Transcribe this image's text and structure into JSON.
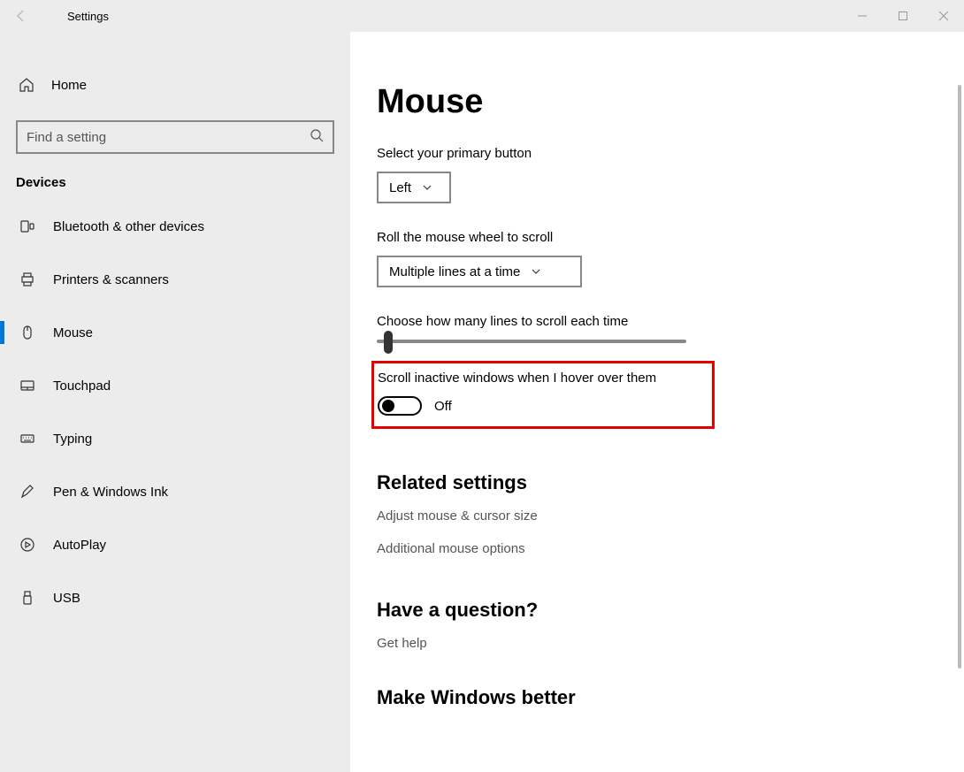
{
  "window": {
    "title": "Settings"
  },
  "sidebar": {
    "home": "Home",
    "search_placeholder": "Find a setting",
    "category": "Devices",
    "items": [
      {
        "label": "Bluetooth & other devices"
      },
      {
        "label": "Printers & scanners"
      },
      {
        "label": "Mouse"
      },
      {
        "label": "Touchpad"
      },
      {
        "label": "Typing"
      },
      {
        "label": "Pen & Windows Ink"
      },
      {
        "label": "AutoPlay"
      },
      {
        "label": "USB"
      }
    ]
  },
  "main": {
    "heading": "Mouse",
    "primary_label": "Select your primary button",
    "primary_value": "Left",
    "scroll_label": "Roll the mouse wheel to scroll",
    "scroll_value": "Multiple lines at a time",
    "lines_label": "Choose how many lines to scroll each time",
    "inactive_label": "Scroll inactive windows when I hover over them",
    "inactive_state": "Off",
    "related_head": "Related settings",
    "related_link1": "Adjust mouse & cursor size",
    "related_link2": "Additional mouse options",
    "question_head": "Have a question?",
    "question_link": "Get help",
    "better_head": "Make Windows better"
  }
}
